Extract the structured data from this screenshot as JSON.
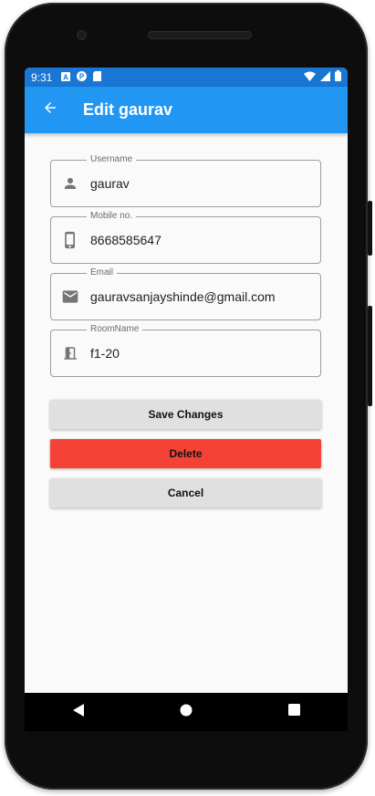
{
  "status_bar": {
    "time": "9:31",
    "icons": [
      "a-icon",
      "p-icon",
      "sd-card-icon"
    ],
    "right_icons": [
      "wifi-icon",
      "signal-icon",
      "battery-icon"
    ]
  },
  "app_bar": {
    "title": "Edit gaurav",
    "back_icon": "arrow-back-icon"
  },
  "form": {
    "username": {
      "label": "Username",
      "value": "gaurav",
      "icon": "person-icon"
    },
    "mobile": {
      "label": "Mobile no.",
      "value": "8668585647",
      "icon": "phone-icon"
    },
    "email": {
      "label": "Email",
      "value": "gauravsanjayshinde@gmail.com",
      "icon": "mail-icon"
    },
    "room": {
      "label": "RoomName",
      "value": "f1-20",
      "icon": "door-icon"
    }
  },
  "buttons": {
    "save": "Save Changes",
    "delete": "Delete",
    "cancel": "Cancel"
  },
  "nav_bar": {
    "items": [
      "back-triangle-icon",
      "home-circle-icon",
      "recents-square-icon"
    ]
  },
  "colors": {
    "status_bar": "#1976d2",
    "app_bar": "#2196f3",
    "delete_button": "#f44336",
    "neutral_button": "#e0e0e0"
  }
}
